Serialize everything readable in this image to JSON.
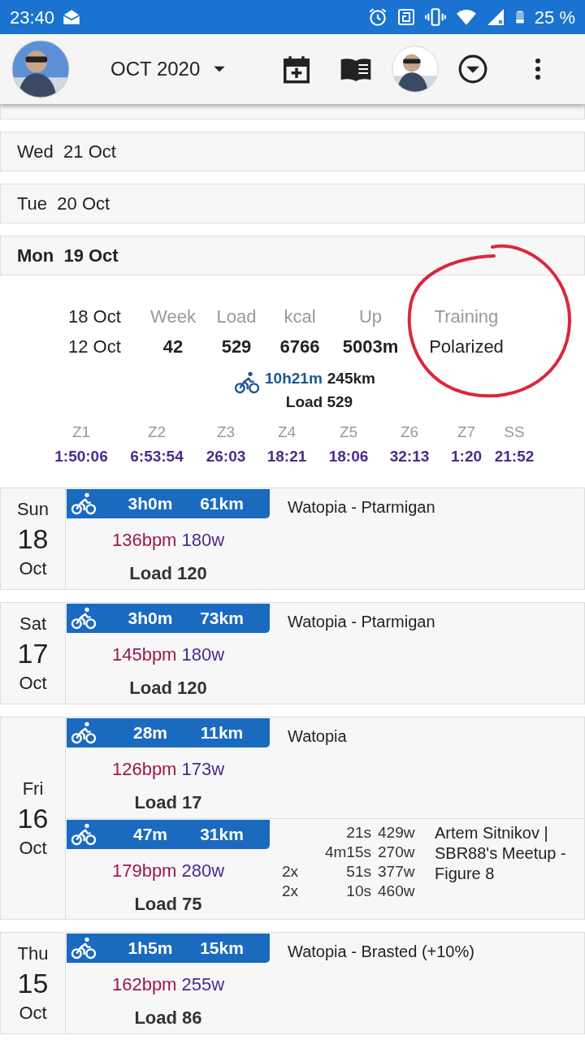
{
  "status_bar": {
    "time": "23:40",
    "battery": "25 %"
  },
  "header": {
    "month": "OCT 2020"
  },
  "days": [
    {
      "label": "Wed  21 Oct",
      "expanded": false
    },
    {
      "label": "Tue  20 Oct",
      "expanded": false
    },
    {
      "label": "Mon  19 Oct",
      "expanded": true
    }
  ],
  "summary": {
    "range_end": "18 Oct",
    "range_start": "12 Oct",
    "columns": [
      {
        "label": "Week",
        "value": "42",
        "kind": "number"
      },
      {
        "label": "Load",
        "value": "529",
        "kind": "number"
      },
      {
        "label": "kcal",
        "value": "6766",
        "kind": "number"
      },
      {
        "label": "Up",
        "value": "5003m",
        "kind": "number"
      },
      {
        "label": "Training",
        "value": "Polarized",
        "kind": "text"
      }
    ],
    "total_duration": "10h21m",
    "total_distance": "245km",
    "total_load": "Load 529",
    "zones": [
      {
        "label": "Z1",
        "value": "1:50:06"
      },
      {
        "label": "Z2",
        "value": "6:53:54"
      },
      {
        "label": "Z3",
        "value": "26:03"
      },
      {
        "label": "Z4",
        "value": "18:21"
      },
      {
        "label": "Z5",
        "value": "18:06"
      },
      {
        "label": "Z6",
        "value": "32:13"
      },
      {
        "label": "Z7",
        "value": "1:20"
      },
      {
        "label": "SS",
        "value": "21:52"
      }
    ]
  },
  "annotation": {
    "color": "#d9283e"
  },
  "activities": [
    {
      "day": "Sun",
      "date": "18",
      "month": "Oct",
      "workouts": [
        {
          "duration": "3h0m",
          "distance": "61km",
          "name": "Watopia - Ptarmigan",
          "hr": "136bpm",
          "power": "180w",
          "load": "Load 120"
        }
      ]
    },
    {
      "day": "Sat",
      "date": "17",
      "month": "Oct",
      "workouts": [
        {
          "duration": "3h0m",
          "distance": "73km",
          "name": "Watopia - Ptarmigan",
          "hr": "145bpm",
          "power": "180w",
          "load": "Load 120"
        }
      ]
    },
    {
      "day": "Fri",
      "date": "16",
      "month": "Oct",
      "workouts": [
        {
          "duration": "28m",
          "distance": "11km",
          "name": "Watopia",
          "hr": "126bpm",
          "power": "173w",
          "load": "Load 17"
        },
        {
          "duration": "47m",
          "distance": "31km",
          "name": "Artem Sitnikov | SBR88's Meetup - Figure 8",
          "hr": "179bpm",
          "power": "280w",
          "load": "Load 75",
          "intervals": [
            {
              "duration": "21s",
              "power": "429w"
            },
            {
              "duration": "4m15s",
              "power": "270w"
            },
            {
              "reps": "2x",
              "duration": "51s",
              "power": "377w"
            },
            {
              "reps": "2x",
              "duration": "10s",
              "power": "460w"
            }
          ]
        }
      ]
    },
    {
      "day": "Thu",
      "date": "15",
      "month": "Oct",
      "workouts": [
        {
          "duration": "1h5m",
          "distance": "15km",
          "name": "Watopia - Brasted (+10%)",
          "hr": "162bpm",
          "power": "255w",
          "load": "Load 86"
        }
      ]
    }
  ]
}
